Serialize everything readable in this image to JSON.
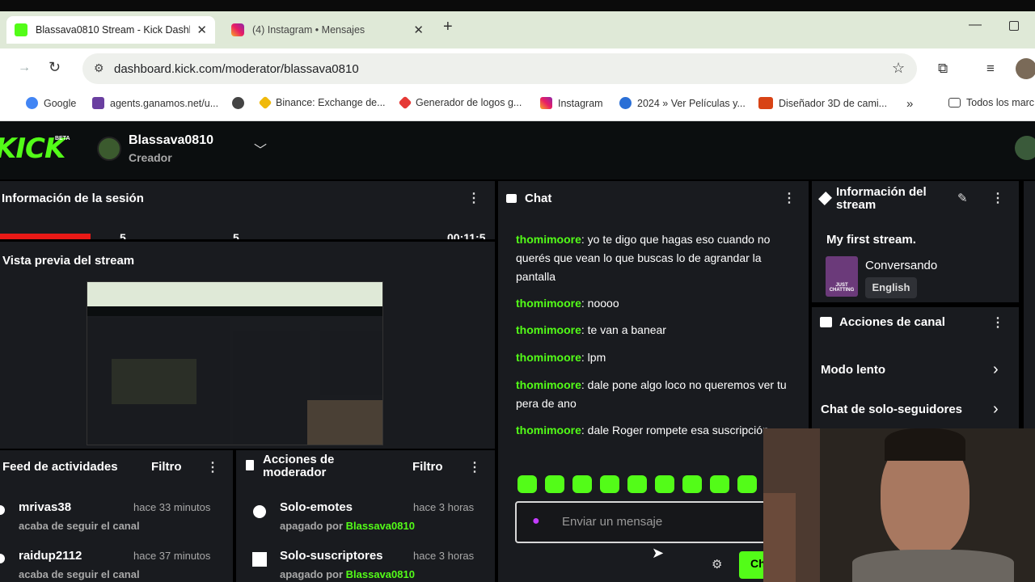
{
  "browser": {
    "tabs": [
      {
        "title": "Blassava0810 Stream - Kick Dashb",
        "active": true
      },
      {
        "title": "(4) Instagram • Mensajes",
        "active": false
      }
    ],
    "url": "dashboard.kick.com/moderator/blassava0810",
    "bookmarks": [
      {
        "label": "Google"
      },
      {
        "label": "agents.ganamos.net/u..."
      },
      {
        "label": ""
      },
      {
        "label": "Binance: Exchange de..."
      },
      {
        "label": "Generador de logos g..."
      },
      {
        "label": "Instagram"
      },
      {
        "label": "2024 » Ver Películas y..."
      },
      {
        "label": "Diseñador 3D de cami..."
      },
      {
        "label": "»"
      },
      {
        "label": "Todos los marc"
      }
    ]
  },
  "header": {
    "logo": "KICK",
    "beta": "BETA",
    "channel_name": "Blassava0810",
    "channel_role": "Creador"
  },
  "session": {
    "title": "Información de la sesión",
    "values": [
      "5",
      "5",
      "00:11:5"
    ]
  },
  "preview": {
    "title": "Vista previa del stream"
  },
  "feed": {
    "title": "Feed de actividades",
    "filter": "Filtro",
    "items": [
      {
        "user": "mrivas38",
        "time": "hace 33 minutos",
        "action": "acaba de seguir el canal"
      },
      {
        "user": "raidup2112",
        "time": "hace 37 minutos",
        "action": "acaba de seguir el canal"
      }
    ]
  },
  "moderator": {
    "title": "Acciones de moderador",
    "filter": "Filtro",
    "items": [
      {
        "action": "Solo-emotes",
        "time": "hace 3 horas",
        "by_label": "apagado por",
        "by": "Blassava0810"
      },
      {
        "action": "Solo-suscriptores",
        "time": "hace 3 horas",
        "by_label": "apagado por",
        "by": "Blassava0810"
      }
    ]
  },
  "chat": {
    "title": "Chat",
    "messages": [
      {
        "user": "thomimoore",
        "text": "yo te digo que hagas eso cuando no querés que vean lo que buscas lo de agrandar la pantalla"
      },
      {
        "user": "thomimoore",
        "text": "noooo"
      },
      {
        "user": "thomimoore",
        "text": "te van a banear"
      },
      {
        "user": "thomimoore",
        "text": "lpm"
      },
      {
        "user": "thomimoore",
        "text": "dale pone algo loco no queremos ver tu pera de ano"
      },
      {
        "user": "thomimoore",
        "text": "dale Roger rompete esa suscripción"
      }
    ],
    "input_placeholder": "Enviar un mensaje",
    "send_label": "Ch"
  },
  "stream_info": {
    "title": "Información del stream",
    "stream_title": "My first stream.",
    "category": "Conversando",
    "language": "English",
    "category_thumb_text": "JUST CHATTING"
  },
  "channel_actions": {
    "title": "Acciones de canal",
    "items": [
      {
        "label": "Modo lento"
      },
      {
        "label": "Chat de solo-seguidores"
      }
    ]
  },
  "colors": {
    "accent": "#53fc18",
    "panel": "#191b1f",
    "live_red": "#e91916"
  }
}
